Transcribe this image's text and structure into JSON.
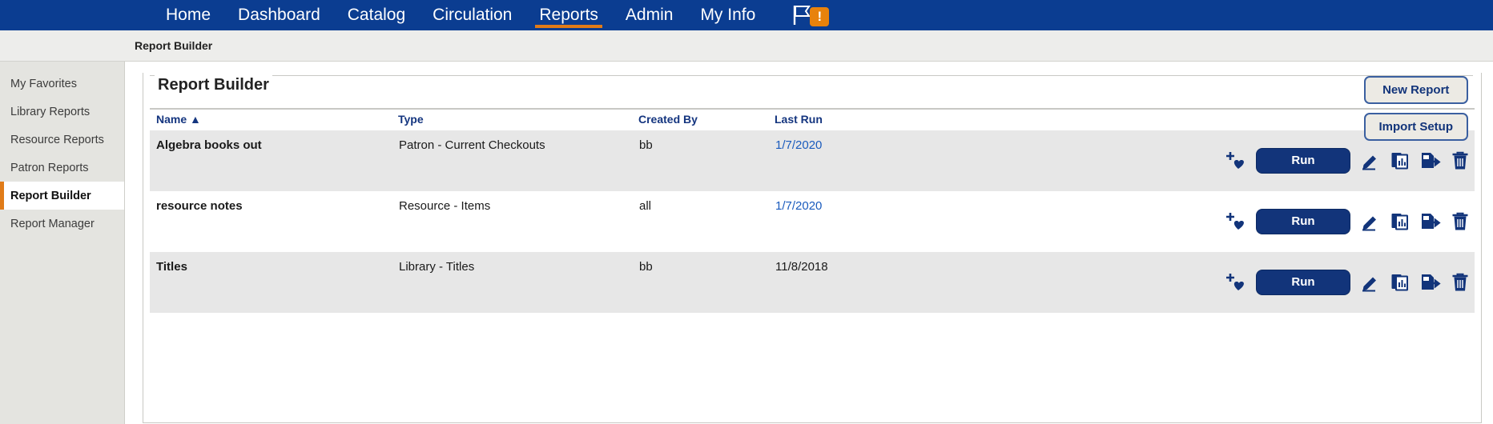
{
  "topnav": {
    "items": [
      {
        "label": "Home",
        "active": false
      },
      {
        "label": "Dashboard",
        "active": false
      },
      {
        "label": "Catalog",
        "active": false
      },
      {
        "label": "Circulation",
        "active": false
      },
      {
        "label": "Reports",
        "active": true
      },
      {
        "label": "Admin",
        "active": false
      },
      {
        "label": "My Info",
        "active": false
      }
    ],
    "flag_icon": "flag-icon",
    "alert_badge": "!",
    "bar_color": "#0b3d91",
    "active_underline_color": "#e07b18"
  },
  "breadcrumb": {
    "text": "Report Builder"
  },
  "sidebar": {
    "items": [
      {
        "label": "My Favorites",
        "active": false
      },
      {
        "label": "Library Reports",
        "active": false
      },
      {
        "label": "Resource Reports",
        "active": false
      },
      {
        "label": "Patron Reports",
        "active": false
      },
      {
        "label": "Report Builder",
        "active": true
      },
      {
        "label": "Report Manager",
        "active": false
      }
    ],
    "active_marker_color": "#e07b18"
  },
  "panel": {
    "title": "Report Builder",
    "new_report_label": "New Report",
    "import_setup_label": "Import Setup"
  },
  "table": {
    "headers": {
      "name": "Name",
      "sort_indicator": "▲",
      "type": "Type",
      "created_by": "Created By",
      "last_run": "Last Run"
    },
    "rows": [
      {
        "name": "Algebra books out",
        "type": "Patron - Current Checkouts",
        "created_by": "bb",
        "last_run": "1/7/2020",
        "last_run_is_link": true,
        "run_label": "Run"
      },
      {
        "name": "resource notes",
        "type": "Resource - Items",
        "created_by": "all",
        "last_run": "1/7/2020",
        "last_run_is_link": true,
        "run_label": "Run"
      },
      {
        "name": "Titles",
        "type": "Library - Titles",
        "created_by": "bb",
        "last_run": "11/8/2018",
        "last_run_is_link": false,
        "run_label": "Run"
      }
    ],
    "row_actions": {
      "favorite_icon": "add-to-favorites-icon",
      "edit_icon": "pencil-edit-icon",
      "duplicate_icon": "duplicate-report-icon",
      "export_icon": "export-report-icon",
      "delete_icon": "trash-delete-icon"
    },
    "accent_color": "#12347a",
    "link_color": "#1a5bbd"
  }
}
